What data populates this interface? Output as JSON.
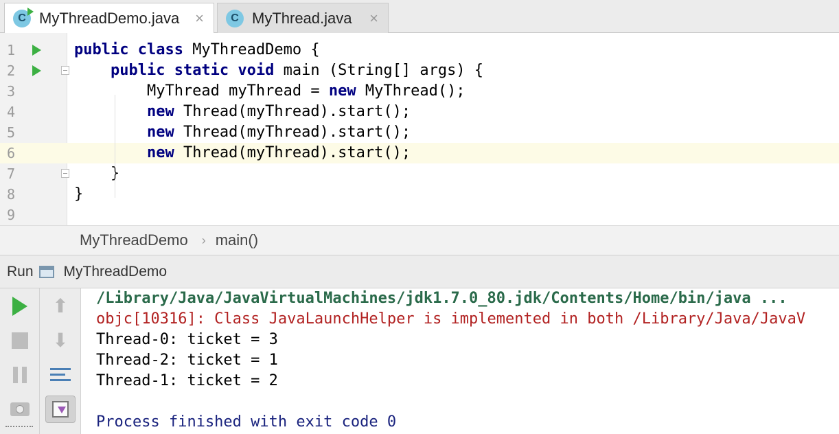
{
  "tabs": [
    {
      "label": "MyThreadDemo.java",
      "icon": "C",
      "active": true
    },
    {
      "label": "MyThread.java",
      "icon": "C",
      "active": false
    }
  ],
  "close_glyph": "×",
  "editor": {
    "line_numbers": [
      "1",
      "2",
      "3",
      "4",
      "5",
      "6",
      "7",
      "8",
      "9"
    ],
    "current_line": 6,
    "code_lines": [
      [
        {
          "t": "public class ",
          "k": true
        },
        {
          "t": "MyThreadDemo {",
          "k": false
        }
      ],
      [
        {
          "t": "    ",
          "k": false
        },
        {
          "t": "public static void ",
          "k": true
        },
        {
          "t": "main (String[] args) {",
          "k": false
        }
      ],
      [
        {
          "t": "        MyThread myThread = ",
          "k": false
        },
        {
          "t": "new ",
          "k": true
        },
        {
          "t": "MyThread();",
          "k": false
        }
      ],
      [
        {
          "t": "        ",
          "k": false
        },
        {
          "t": "new ",
          "k": true
        },
        {
          "t": "Thread(myThread).start();",
          "k": false
        }
      ],
      [
        {
          "t": "        ",
          "k": false
        },
        {
          "t": "new ",
          "k": true
        },
        {
          "t": "Thread(myThread).start();",
          "k": false
        }
      ],
      [
        {
          "t": "        ",
          "k": false
        },
        {
          "t": "new ",
          "k": true
        },
        {
          "t": "Thread(myThread).start();",
          "k": false
        }
      ],
      [
        {
          "t": "    }",
          "k": false
        }
      ],
      [
        {
          "t": "}",
          "k": false
        }
      ],
      []
    ]
  },
  "breadcrumb": {
    "class_name": "MyThreadDemo",
    "separator": "›",
    "method": "main()"
  },
  "run_panel": {
    "title": "Run",
    "config_name": "MyThreadDemo",
    "console_lines": [
      {
        "text": "/Library/Java/JavaVirtualMachines/jdk1.7.0_80.jdk/Contents/Home/bin/java ...",
        "kind": "cmd"
      },
      {
        "text": "objc[10316]: Class JavaLaunchHelper is implemented in both /Library/Java/JavaV",
        "kind": "err"
      },
      {
        "text": "Thread-0: ticket = 3",
        "kind": "out"
      },
      {
        "text": "Thread-2: ticket = 1",
        "kind": "out"
      },
      {
        "text": "Thread-1: ticket = 2",
        "kind": "out"
      },
      {
        "text": "",
        "kind": "out"
      },
      {
        "text": "Process finished with exit code 0",
        "kind": "exit"
      }
    ]
  },
  "colors": {
    "keyword": "#000080",
    "run_green": "#3cb043",
    "current_line": "#fdfbe6",
    "error": "#b22222"
  }
}
